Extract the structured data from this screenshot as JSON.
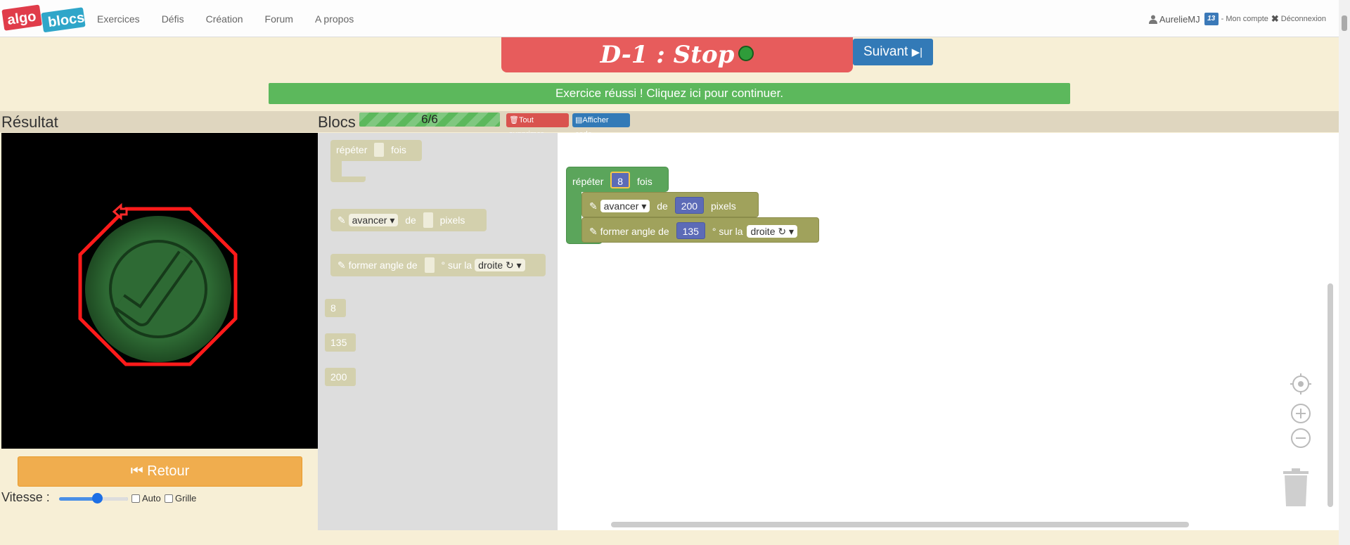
{
  "nav": {
    "logo_left": "algo",
    "logo_right": "blocs",
    "links": [
      "Exercices",
      "Défis",
      "Création",
      "Forum",
      "A propos"
    ],
    "user": "AurelieMJ",
    "badge": "13",
    "account": "- Mon compte",
    "logout": "Déconnexion"
  },
  "header": {
    "title": "D-1 : Stop",
    "next_label": "Suivant",
    "success_message": "Exercice réussi ! Cliquez ici pour continuer."
  },
  "result": {
    "heading": "Résultat",
    "back_label": "Retour",
    "speed_label": "Vitesse :",
    "speed_value": 0.55,
    "auto_label": "Auto",
    "grid_label": "Grille"
  },
  "blocs": {
    "heading": "Blocs",
    "progress": "6/6",
    "delete_all": "Tout supprimer",
    "show_code": "Afficher code"
  },
  "toolbox": {
    "repeat": {
      "left": "répéter",
      "right": "fois"
    },
    "forward": {
      "dropdown": "avancer",
      "mid": "de",
      "right": "pixels"
    },
    "turn": {
      "left": "former angle de",
      "mid": "° sur la",
      "dropdown": "droite ↻"
    },
    "values": [
      "8",
      "135",
      "200"
    ]
  },
  "program": {
    "repeat_label": "répéter",
    "repeat_count": "8",
    "repeat_suffix": "fois",
    "forward_dropdown": "avancer",
    "forward_mid": "de",
    "forward_value": "200",
    "forward_suffix": "pixels",
    "turn_label": "former angle de",
    "turn_value": "135",
    "turn_mid": "° sur la",
    "turn_dropdown": "droite ↻"
  },
  "colors": {
    "title_bg": "#e75c5c",
    "success": "#5cb85c",
    "primary": "#337ab7",
    "warning": "#f0ad4e",
    "loop_block": "#5ba55b",
    "pen_block": "#a0a25c",
    "number_block": "#5c6bb7"
  }
}
